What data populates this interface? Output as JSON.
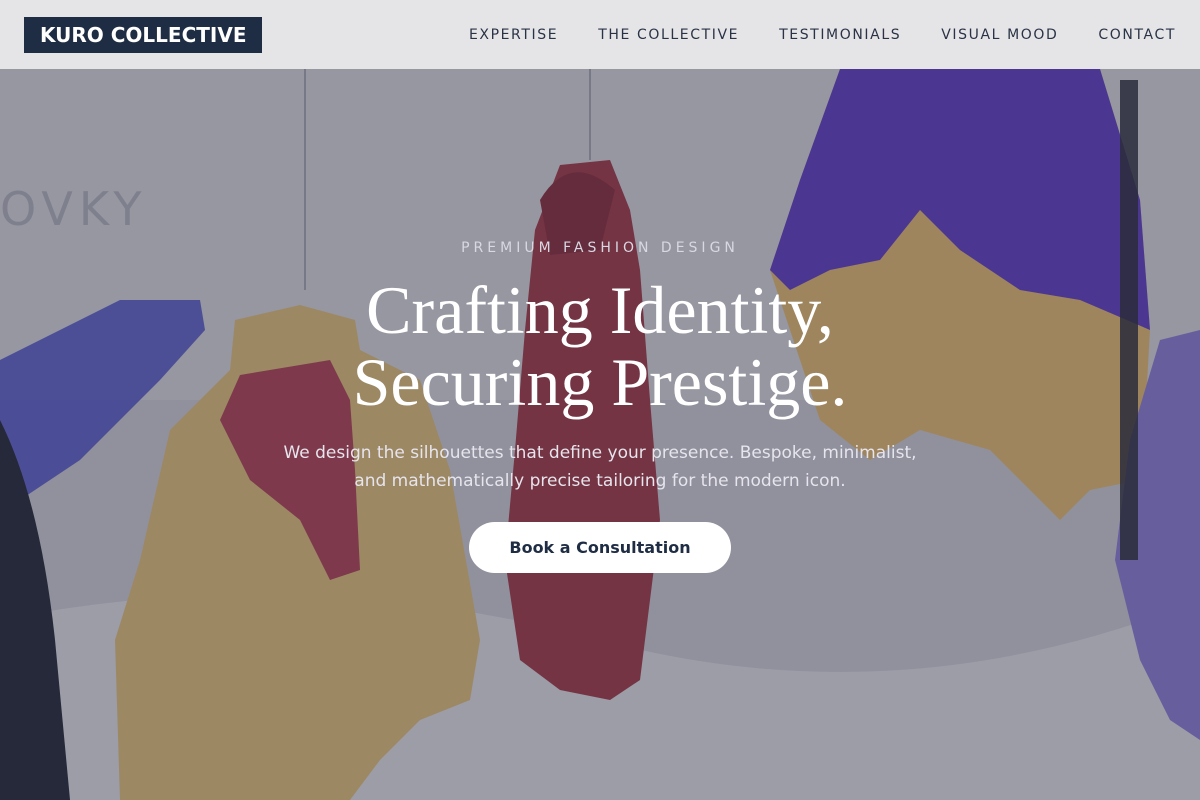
{
  "brand": {
    "logo_text": "KURO COLLECTIVE"
  },
  "nav": {
    "links": [
      {
        "label": "EXPERTISE"
      },
      {
        "label": "THE COLLECTIVE"
      },
      {
        "label": "TESTIMONIALS"
      },
      {
        "label": "VISUAL MOOD"
      },
      {
        "label": "CONTACT"
      }
    ]
  },
  "hero": {
    "eyebrow": "PREMIUM FASHION DESIGN",
    "headline_line1": "Crafting Identity,",
    "headline_line2": "Securing Prestige.",
    "subtext_line1": "We design the silhouettes that define your presence. Bespoke, minimalist,",
    "subtext_line2": "and mathematically precise tailoring for the modern icon.",
    "cta_label": "Book a Consultation",
    "background_description_icon": "hanging-garments-photo"
  },
  "colors": {
    "brand_navy": "#1f2d44",
    "nav_bg": "#e8e8eb",
    "overlay": "#3a3c4e",
    "cta_bg": "#ffffff"
  }
}
